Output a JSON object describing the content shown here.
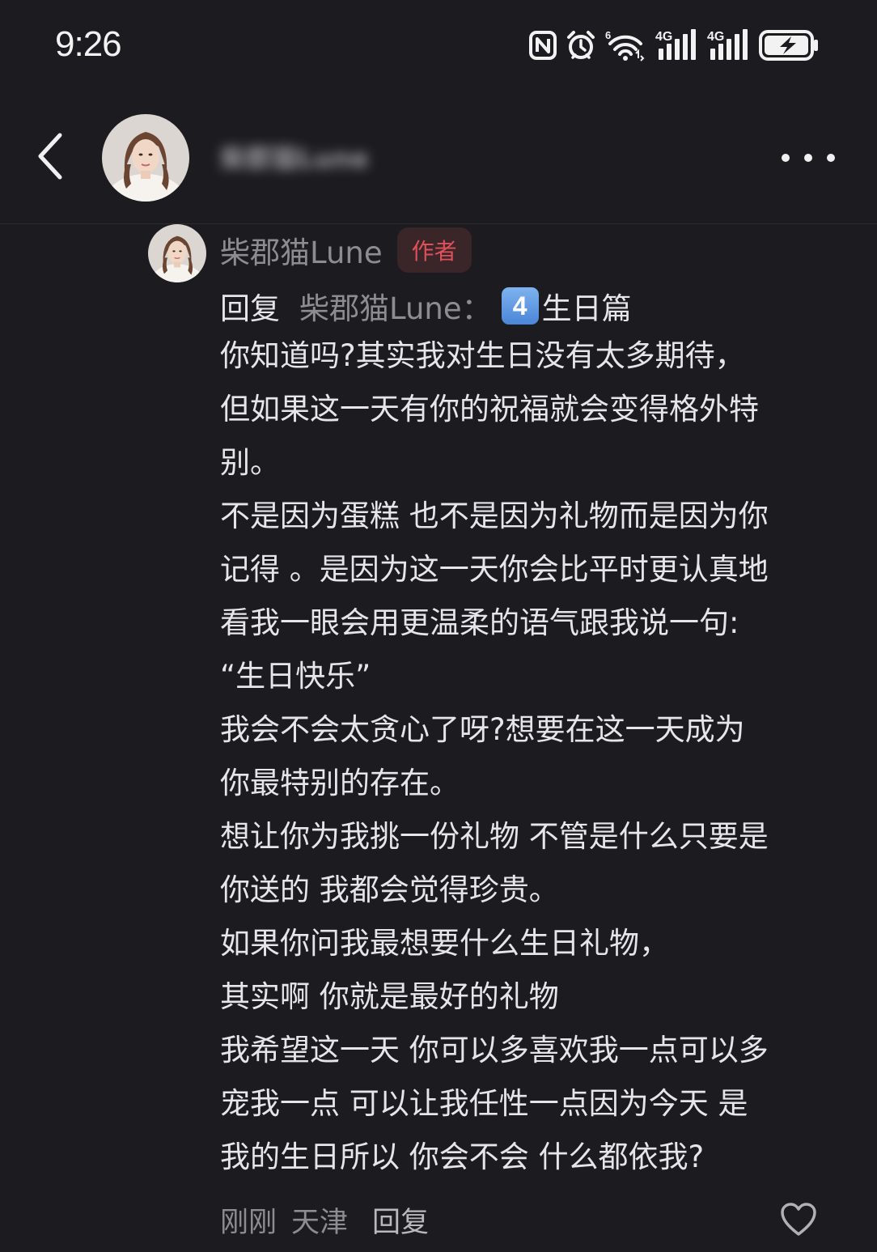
{
  "status_bar": {
    "time": "9:26",
    "icons": [
      "nfc-icon",
      "alarm-icon",
      "wifi-icon",
      "signal-4g-icon",
      "signal-4g-icon",
      "battery-charging-icon"
    ],
    "network_labels": [
      "6",
      "4G",
      "4G"
    ]
  },
  "header": {
    "back_icon": "chevron-left-icon",
    "title_blurred": "柴郡猫Lune",
    "more_icon": "more-horizontal-icon"
  },
  "comment": {
    "author": "柴郡猫Lune",
    "badge": "作者",
    "reply_prefix": "回复",
    "reply_target": "柴郡猫Lune：",
    "reply_emoji": "4",
    "reply_title": "生日篇",
    "lines": [
      "你知道吗?其实我对生日没有太多期待，",
      "但如果这一天有你的祝福就会变得格外特",
      "别。",
      "不是因为蛋糕 也不是因为礼物而是因为你",
      "记得 。是因为这一天你会比平时更认真地",
      "看我一眼会用更温柔的语气跟我说一句:",
      "“生日快乐”",
      "我会不会太贪心了呀?想要在这一天成为",
      "你最特别的存在。",
      "想让你为我挑一份礼物 不管是什么只要是",
      "你送的 我都会觉得珍贵。",
      "如果你问我最想要什么生日礼物，",
      "其实啊 你就是最好的礼物",
      "我希望这一天 你可以多喜欢我一点可以多",
      "宠我一点 可以让我任性一点因为今天 是",
      "我的生日所以 你会不会 什么都依我?"
    ],
    "footer": {
      "time": "刚刚",
      "location": "天津",
      "reply_label": "回复",
      "like_icon": "heart-outline-icon"
    }
  },
  "colors": {
    "background": "#1c1c20",
    "text_primary": "#e6e6e8",
    "text_secondary": "#8c8c92",
    "badge_text": "#e0505a",
    "badge_bg": "#3a2528"
  }
}
